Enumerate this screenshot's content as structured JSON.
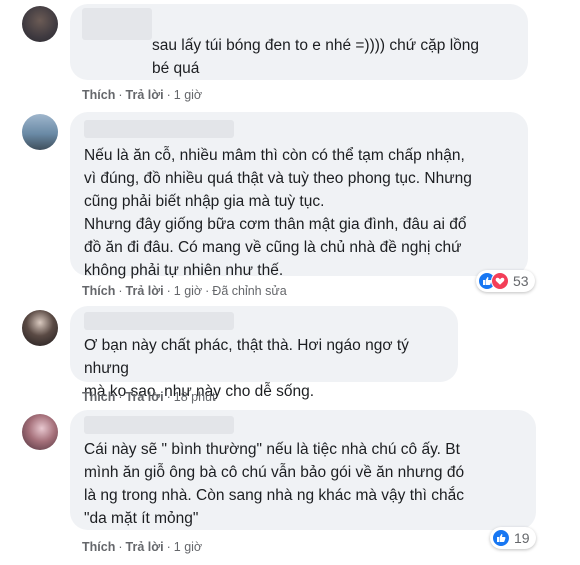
{
  "comments": [
    {
      "text": "sau lấy túi bóng đen to e nhé =)))) chứ cặp lồng\nbé quá",
      "like_label": "Thích",
      "reply_label": "Trả lời",
      "time": "1 giờ",
      "edited": ""
    },
    {
      "text": "Nếu là ăn cỗ, nhiều mâm thì còn có thể tạm chấp nhận,\nvì đúng, đồ nhiều quá thật và tuỳ theo phong tục. Nhưng\ncũng phải biết nhập gia mà tuỳ tục.\nNhưng đây giống bữa cơm thân mật gia đình, đâu ai đổ\nđồ ăn đi đâu. Có mang về cũng là chủ nhà đề nghị chứ\nkhông phải tự nhiên như thế.",
      "like_label": "Thích",
      "reply_label": "Trả lời",
      "time": "1 giờ",
      "edited": "Đã chỉnh sửa",
      "reaction_count": "53",
      "reactions": [
        "like-icon",
        "love-icon"
      ]
    },
    {
      "text": "Ơ bạn này chất phác, thật thà. Hơi ngáo ngơ tý nhưng\nmà ko sao, như này cho dễ sống.",
      "like_label": "Thích",
      "reply_label": "Trả lời",
      "time": "18 phút",
      "edited": ""
    },
    {
      "text": "Cái này sẽ \" bình thường\" nếu là tiệc nhà chú cô ấy. Bt\nmình ăn giỗ ông bà cô chú vẫn bảo gói về ăn nhưng đó\nlà ng trong nhà. Còn sang nhà ng khác mà vậy thì chắc\n\"da mặt ít mỏng\"",
      "like_label": "Thích",
      "reply_label": "Trả lời",
      "time": "1 giờ",
      "edited": "",
      "reaction_count": "19",
      "reactions": [
        "like-icon"
      ]
    }
  ],
  "colors": {
    "bubble": "#f0f2f5",
    "like_blue": "#1877f2",
    "love_red": "#f33e58",
    "meta_gray": "#65676b"
  }
}
